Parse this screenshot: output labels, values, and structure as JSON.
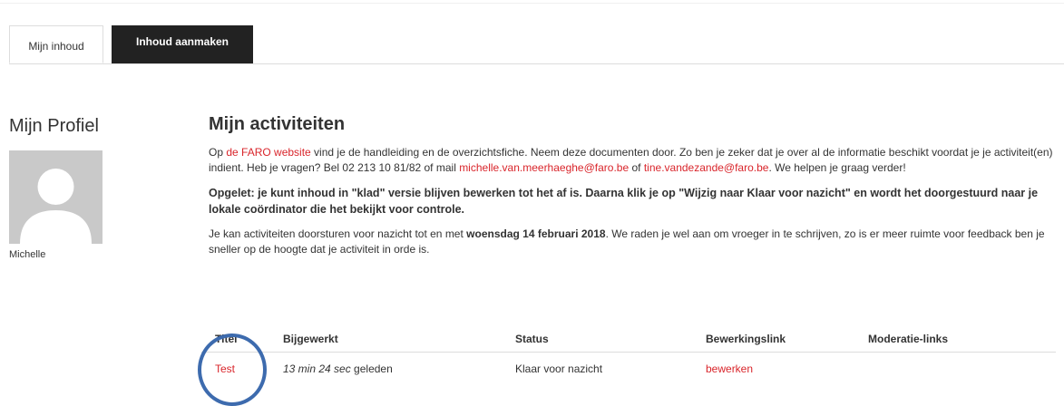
{
  "tabs": [
    {
      "label": "Mijn inhoud",
      "active": true
    },
    {
      "label": "Inhoud aanmaken",
      "active": false
    }
  ],
  "profile": {
    "title": "Mijn Profiel",
    "name": "Michelle"
  },
  "main": {
    "title": "Mijn activiteiten",
    "intro": {
      "pre_link1": "Op ",
      "link1": "de FARO website",
      "mid1": " vind je de handleiding en de overzichtsfiche. Neem deze documenten door. Zo ben je zeker dat je over al de informatie beschikt voordat je je activiteit(en) indient. Heb je vragen? Bel 02 213 10 81/82 of mail ",
      "link2": "michelle.van.meerhaeghe@faro.be",
      "mid2": " of ",
      "link3": "tine.vandezande@faro.be",
      "post": ". We helpen je graag verder!"
    },
    "warning": "Opgelet: je kunt inhoud in \"klad\" versie blijven bewerken tot het af is. Daarna klik je op \"Wijzig naar Klaar voor nazicht\" en wordt het doorgestuurd naar je lokale coördinator die het bekijkt voor controle.",
    "deadline": {
      "pre": "Je kan activiteiten doorsturen voor nazicht tot en met ",
      "date": "woensdag 14 februari 2018",
      "post": ". We raden je wel aan om vroeger in te schrijven, zo is er meer ruimte voor feedback ben je sneller op de hoogte dat je activiteit in orde is."
    }
  },
  "table": {
    "headers": [
      "Titel",
      "Bijgewerkt",
      "Status",
      "Bewerkingslink",
      "Moderatie-links"
    ],
    "rows": [
      {
        "title": "Test",
        "updated_italic": "13 min 24 sec",
        "updated_suffix": " geleden",
        "status": "Klaar voor nazicht",
        "edit_link": "bewerken",
        "moderation": ""
      }
    ]
  },
  "colors": {
    "link": "#d9252b",
    "tab_dark": "#222222",
    "highlight": "#3d6bae"
  }
}
